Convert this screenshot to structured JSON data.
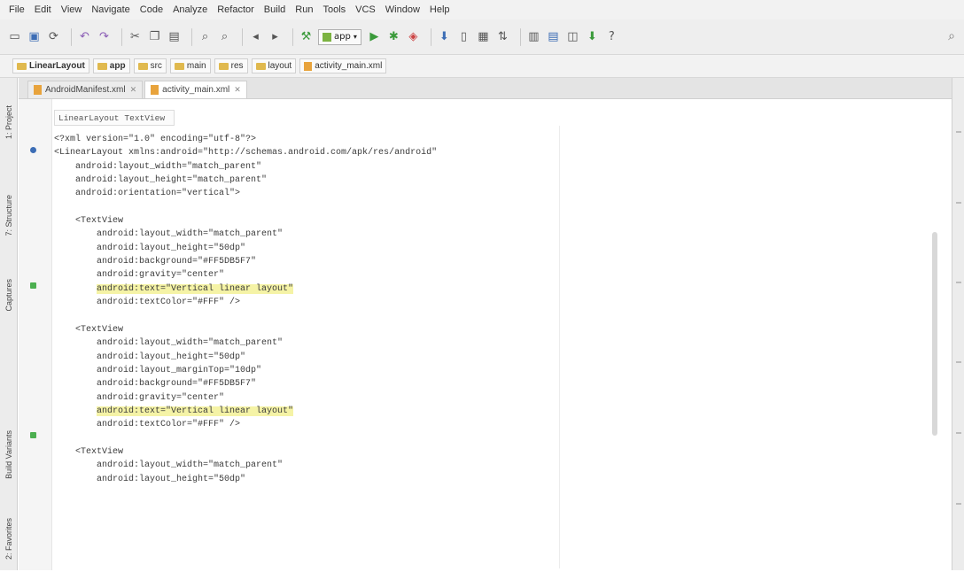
{
  "menu": [
    "File",
    "Edit",
    "View",
    "Navigate",
    "Code",
    "Analyze",
    "Refactor",
    "Build",
    "Run",
    "Tools",
    "VCS",
    "Window",
    "Help"
  ],
  "toolbar": {
    "run_config": "app",
    "help_label": "?"
  },
  "breadcrumbs": [
    "LinearLayout",
    "app",
    "src",
    "main",
    "res",
    "layout",
    "activity_main.xml"
  ],
  "left_tools": [
    "1: Project",
    "7: Structure",
    "Captures",
    "Build Variants",
    "2: Favorites"
  ],
  "editor_tabs": [
    {
      "label": "AndroidManifest.xml",
      "active": false
    },
    {
      "label": "activity_main.xml",
      "active": true
    }
  ],
  "structure_crumbs": [
    "LinearLayout",
    "TextView"
  ],
  "code_lines": [
    {
      "pre": "<?xml version=\"1.0\" encoding=\"utf-8\"?>",
      "hl": "",
      "post": ""
    },
    {
      "pre": "<LinearLayout xmlns:android=\"http://schemas.android.com/apk/res/android\"",
      "hl": "",
      "post": ""
    },
    {
      "pre": "    android:layout_width=\"match_parent\"",
      "hl": "",
      "post": ""
    },
    {
      "pre": "    android:layout_height=\"match_parent\"",
      "hl": "",
      "post": ""
    },
    {
      "pre": "    android:orientation=\"vertical\">",
      "hl": "",
      "post": ""
    },
    {
      "pre": "",
      "hl": "",
      "post": ""
    },
    {
      "pre": "    <TextView",
      "hl": "",
      "post": ""
    },
    {
      "pre": "        android:layout_width=\"match_parent\"",
      "hl": "",
      "post": ""
    },
    {
      "pre": "        android:layout_height=\"50dp\"",
      "hl": "",
      "post": ""
    },
    {
      "pre": "        android:background=\"#FF5DB5F7\"",
      "hl": "",
      "post": ""
    },
    {
      "pre": "        android:gravity=\"center\"",
      "hl": "",
      "post": ""
    },
    {
      "pre": "        ",
      "hl": "android:text=\"Vertical linear layout\"",
      "post": ""
    },
    {
      "pre": "        android:textColor=\"#FFF\" />",
      "hl": "",
      "post": ""
    },
    {
      "pre": "",
      "hl": "",
      "post": ""
    },
    {
      "pre": "    <TextView",
      "hl": "",
      "post": ""
    },
    {
      "pre": "        android:layout_width=\"match_parent\"",
      "hl": "",
      "post": ""
    },
    {
      "pre": "        android:layout_height=\"50dp\"",
      "hl": "",
      "post": ""
    },
    {
      "pre": "        android:layout_marginTop=\"10dp\"",
      "hl": "",
      "post": ""
    },
    {
      "pre": "        android:background=\"#FF5DB5F7\"",
      "hl": "",
      "post": ""
    },
    {
      "pre": "        android:gravity=\"center\"",
      "hl": "",
      "post": ""
    },
    {
      "pre": "        ",
      "hl": "android:text=\"Vertical linear layout\"",
      "post": ""
    },
    {
      "pre": "        android:textColor=\"#FFF\" />",
      "hl": "",
      "post": ""
    },
    {
      "pre": "",
      "hl": "",
      "post": ""
    },
    {
      "pre": "    <TextView",
      "hl": "",
      "post": ""
    },
    {
      "pre": "        android:layout_width=\"match_parent\"",
      "hl": "",
      "post": ""
    },
    {
      "pre": "        android:layout_height=\"50dp\"",
      "hl": "",
      "post": ""
    }
  ],
  "colors": {
    "highlight": "#f5f3a6",
    "gutter_green": "#4caf50",
    "gutter_blue": "#3c6db5"
  }
}
